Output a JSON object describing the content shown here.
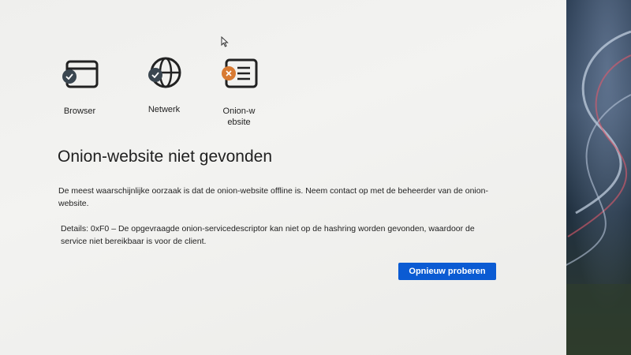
{
  "stages": [
    {
      "label": "Browser",
      "icon": "browser-window-icon",
      "status": "ok"
    },
    {
      "label": "Netwerk",
      "icon": "globe-icon",
      "status": "ok"
    },
    {
      "label": "Onion-website",
      "icon": "onion-site-icon",
      "status": "error"
    }
  ],
  "error": {
    "title": "Onion-website niet gevonden",
    "description": "De meest waarschijnlijke oorzaak is dat de onion-website offline is. Neem contact op met de beheerder van de onion-website.",
    "details": "Details: 0xF0 – De opgevraagde onion-servicedescriptor kan niet op de hashring worden gevonden, waardoor de service niet bereikbaar is voor de client."
  },
  "actions": {
    "retry_label": "Opnieuw proberen"
  },
  "colors": {
    "accent": "#0b5bd3",
    "ok_badge": "#3a4650",
    "error_badge": "#d87a32"
  }
}
